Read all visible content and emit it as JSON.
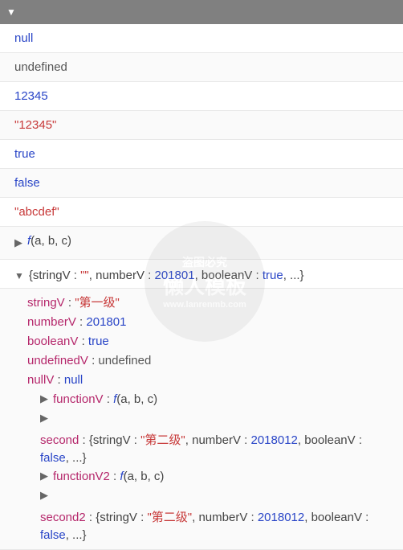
{
  "header": {
    "caret": "▼"
  },
  "rows": {
    "r0": "null",
    "r1": "undefined",
    "r2": "12345",
    "r3": "\"12345\"",
    "r4": "true",
    "r5": "false",
    "r6": "\"abcdef\""
  },
  "fn_closed": {
    "sig": "f",
    "args": "(a, b, c)"
  },
  "obj": {
    "summary": {
      "k0": "stringV",
      "v0": "\"\"",
      "k1": "numberV",
      "v1": "201801",
      "k2": "booleanV",
      "v2": "true",
      "ell": "..."
    },
    "props": {
      "stringV": {
        "k": "stringV",
        "v": "\"第一级\""
      },
      "numberV": {
        "k": "numberV",
        "v": "201801"
      },
      "booleanV": {
        "k": "booleanV",
        "v": "true"
      },
      "undefinedV": {
        "k": "undefinedV",
        "v": "undefined"
      },
      "nullV": {
        "k": "nullV",
        "v": "null"
      },
      "functionV": {
        "k": "functionV",
        "sig": "f",
        "args": "(a, b, c)"
      },
      "second": {
        "k": "second",
        "k0": "stringV",
        "v0": "\"第二级\"",
        "k1": "numberV",
        "v1": "2018012",
        "k2": "booleanV",
        "v2": "false",
        "ell": "..."
      },
      "functionV2": {
        "k": "functionV2",
        "sig": "f",
        "args": "(a, b, c)"
      },
      "second2": {
        "k": "second2",
        "k0": "stringV",
        "v0": "\"第二级\"",
        "k1": "numberV",
        "v1": "2018012",
        "k2": "booleanV",
        "v2": "false",
        "ell": "..."
      }
    }
  },
  "watermark": {
    "top": "盗图必究",
    "mid": "懒人模板",
    "bot": "www.lanrenmb.com"
  },
  "glyph": {
    "lbrace": "{",
    "rbrace": "}",
    "colon": " : ",
    "comma": ", ",
    "caret_right": "▶",
    "caret_down": "▼"
  }
}
